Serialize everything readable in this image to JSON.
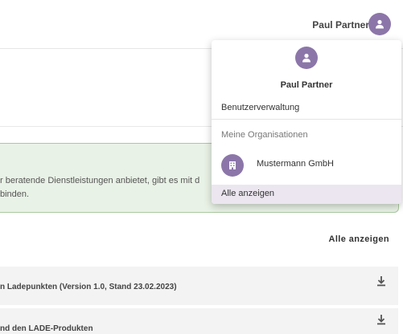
{
  "header": {
    "user_name": "Paul Partner"
  },
  "banner": {
    "line1": "r beratende Dienstleistungen anbietet, gibt es mit d",
    "line2": "binden."
  },
  "documents": {
    "show_all_label": "Alle anzeigen",
    "items": [
      {
        "title": "n Ladepunkten (Version 1.0, Stand 23.02.2023)"
      },
      {
        "title": "nd den LADE-Produkten"
      }
    ]
  },
  "user_menu": {
    "name": "Paul Partner",
    "user_admin_label": "Benutzerverwaltung",
    "orgs_heading": "Meine Organisationen",
    "org_name": "Mustermann GmbH",
    "show_all_label": "Alle anzeigen"
  },
  "colors": {
    "accent": "#8c76a9",
    "banner_bg": "#e9f2e6",
    "banner_border": "#a9c9a0"
  }
}
